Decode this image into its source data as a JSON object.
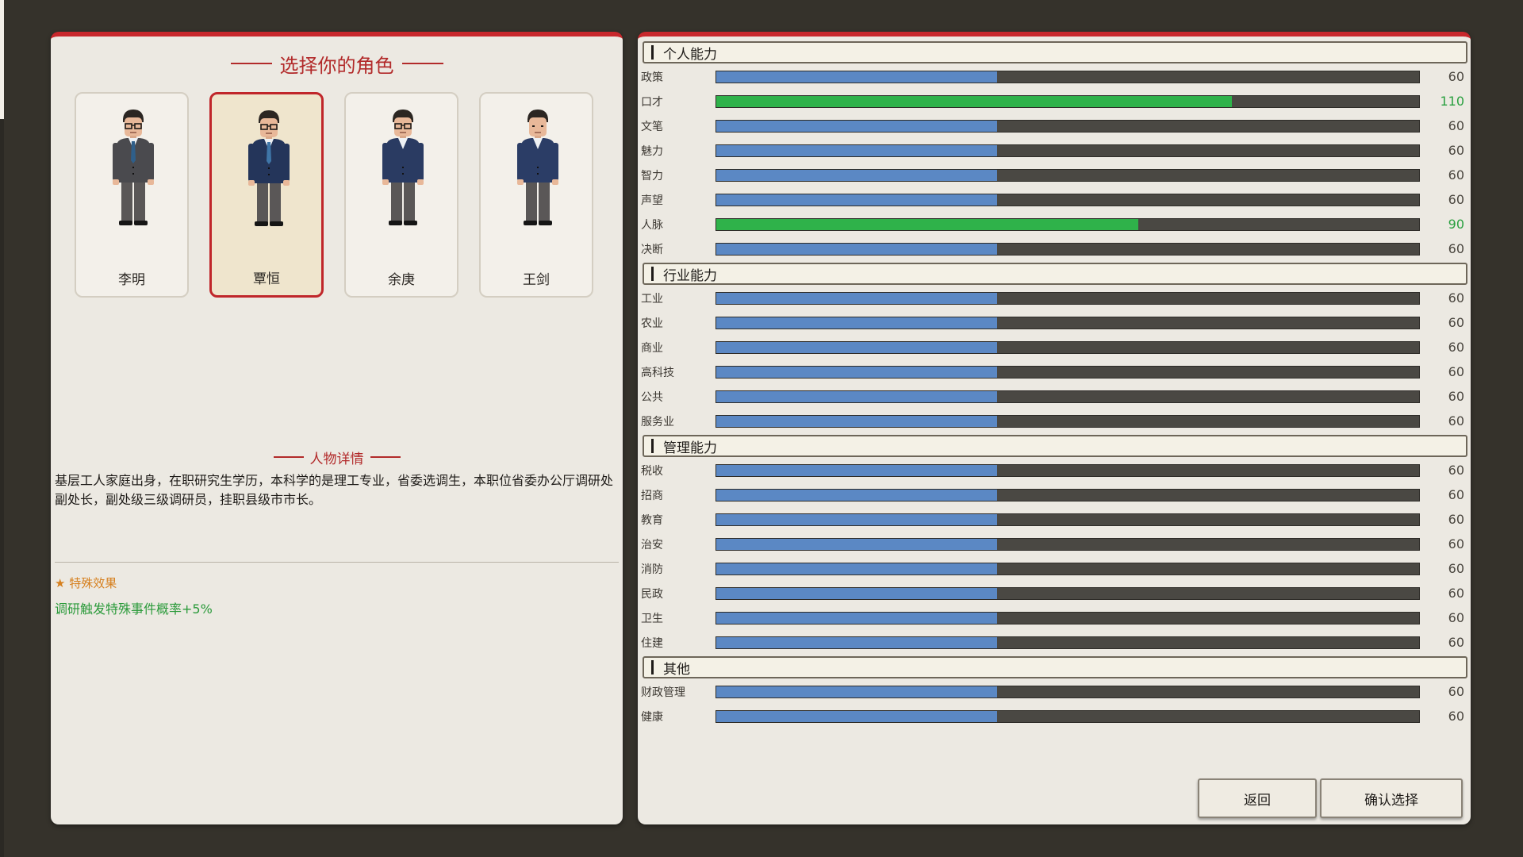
{
  "character_select": {
    "title": "选择你的角色",
    "characters": [
      {
        "name": "李明",
        "suit": "#4a4a4e",
        "pants": "#5a5757",
        "glasses": true,
        "tie": "#2f5f8a",
        "selected": false
      },
      {
        "name": "覃恒",
        "suit": "#24355a",
        "pants": "#5a5757",
        "glasses": true,
        "tie": "#3f76a8",
        "selected": true
      },
      {
        "name": "余庚",
        "suit": "#2a3b62",
        "pants": "#5a5757",
        "glasses": true,
        "tie": null,
        "selected": false
      },
      {
        "name": "王剑",
        "suit": "#2b3d66",
        "pants": "#5a5757",
        "glasses": false,
        "tie": null,
        "selected": false
      }
    ]
  },
  "details": {
    "heading": "人物详情",
    "bio": "基层工人家庭出身，在职研究生学历，本科学的是理工专业，省委选调生，本职位省委办公厅调研处副处长，副处级三级调研员，挂职县级市市长。",
    "special_title": "★ 特殊效果",
    "special_effect": "调研触发特殊事件概率+5%"
  },
  "stats": {
    "max_value": 150,
    "sections": [
      {
        "title": "个人能力",
        "items": [
          {
            "label": "政策",
            "value": 60
          },
          {
            "label": "口才",
            "value": 110
          },
          {
            "label": "文笔",
            "value": 60
          },
          {
            "label": "魅力",
            "value": 60
          },
          {
            "label": "智力",
            "value": 60
          },
          {
            "label": "声望",
            "value": 60
          },
          {
            "label": "人脉",
            "value": 90
          },
          {
            "label": "决断",
            "value": 60
          }
        ]
      },
      {
        "title": "行业能力",
        "items": [
          {
            "label": "工业",
            "value": 60
          },
          {
            "label": "农业",
            "value": 60
          },
          {
            "label": "商业",
            "value": 60
          },
          {
            "label": "高科技",
            "value": 60
          },
          {
            "label": "公共",
            "value": 60
          },
          {
            "label": "服务业",
            "value": 60
          }
        ]
      },
      {
        "title": "管理能力",
        "items": [
          {
            "label": "税收",
            "value": 60
          },
          {
            "label": "招商",
            "value": 60
          },
          {
            "label": "教育",
            "value": 60
          },
          {
            "label": "治安",
            "value": 60
          },
          {
            "label": "消防",
            "value": 60
          },
          {
            "label": "民政",
            "value": 60
          },
          {
            "label": "卫生",
            "value": 60
          },
          {
            "label": "住建",
            "value": 60
          }
        ]
      },
      {
        "title": "其他",
        "items": [
          {
            "label": "财政管理",
            "value": 60
          },
          {
            "label": "健康",
            "value": 60
          }
        ]
      }
    ]
  },
  "buttons": {
    "back": "返回",
    "confirm": "确认选择"
  },
  "colors": {
    "accent_red": "#c8282c",
    "bar_normal": "#5b88c4",
    "bar_high": "#2fb24a",
    "value_high": "#2aa040",
    "special_title": "#d6801f",
    "special_effect": "#2a9a3a"
  }
}
